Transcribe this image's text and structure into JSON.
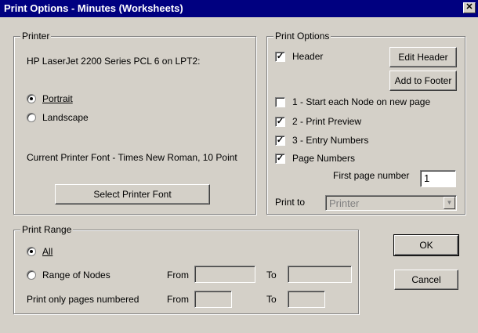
{
  "window": {
    "title": "Print Options - Minutes (Worksheets)",
    "close_glyph": "✕"
  },
  "printer": {
    "legend": "Printer",
    "printer_name": "HP LaserJet 2200 Series PCL 6 on LPT2:",
    "portrait_label": "Portrait",
    "landscape_label": "Landscape",
    "orientation": "Portrait",
    "font_info": "Current Printer Font - Times New Roman, 10 Point",
    "select_font_label": "Select Printer Font"
  },
  "print_options": {
    "legend": "Print Options",
    "header_label": "Header",
    "header_checked": true,
    "edit_header_label": "Edit Header",
    "add_to_footer_label": "Add to Footer",
    "start_each_node_label": "1 - Start each Node on new page",
    "start_each_node_checked": false,
    "print_preview_label": "2 - Print Preview",
    "print_preview_checked": true,
    "entry_numbers_label": "3 - Entry Numbers",
    "entry_numbers_checked": true,
    "page_numbers_label": "Page Numbers",
    "page_numbers_checked": true,
    "first_page_label": "First page number",
    "first_page_value": "1",
    "print_to_label": "Print to",
    "print_to_value": "Printer"
  },
  "print_range": {
    "legend": "Print Range",
    "all_label": "All",
    "range_label": "Range of Nodes",
    "selected": "All",
    "from_label": "From",
    "to_label": "To",
    "from_value": "",
    "to_value": "",
    "pages_label": "Print only pages numbered",
    "pages_from_label": "From",
    "pages_to_label": "To",
    "pages_from_value": "",
    "pages_to_value": ""
  },
  "buttons": {
    "ok_label": "OK",
    "cancel_label": "Cancel"
  },
  "colors": {
    "face": "#d4d0c8",
    "titlebar": "#000080",
    "disabled_text": "#808080"
  }
}
